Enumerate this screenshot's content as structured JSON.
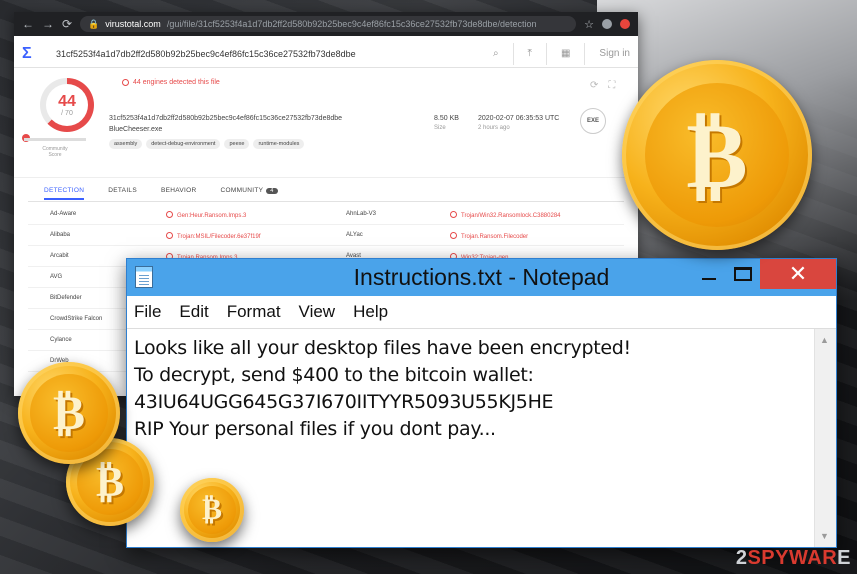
{
  "browser": {
    "url_host": "virustotal.com",
    "url_path": "/gui/file/31cf5253f4a1d7db2ff2d580b92b25bec9c4ef86fc15c36ce27532fb73de8dbe/detection",
    "search_query": "31cf5253f4a1d7db2ff2d580b92b25bec9c4ef86fc15c36ce27532fb73de8dbe",
    "sign_in": "Sign in"
  },
  "summary": {
    "score": "44",
    "score_total": "/ 70",
    "community_label": "Community Score",
    "detected_text": "44 engines detected this file",
    "hash": "31cf5253f4a1d7db2ff2d580b92b25bec9c4ef86fc15c36ce27532fb73de8dbe",
    "filename": "BlueCheeser.exe",
    "tags": [
      "assembly",
      "detect-debug-environment",
      "peexe",
      "runtime-modules"
    ],
    "size": "8.50 KB",
    "size_label": "Size",
    "date": "2020-02-07 06:35:53 UTC",
    "date_sub": "2 hours ago",
    "type": "EXE"
  },
  "tabs": {
    "detection": "DETECTION",
    "details": "DETAILS",
    "behavior": "BEHAVIOR",
    "community": "COMMUNITY",
    "community_count": "4"
  },
  "detections": [
    {
      "engine1": "Ad-Aware",
      "result1": "Gen:Heur.Ransom.Imps.3",
      "engine2": "AhnLab-V3",
      "result2": "Trojan/Win32.Ransomlock.C3880284"
    },
    {
      "engine1": "Alibaba",
      "result1": "Trojan:MSIL/Filecoder.6e37f19f",
      "engine2": "ALYac",
      "result2": "Trojan.Ransom.Filecoder"
    },
    {
      "engine1": "Arcabit",
      "result1": "Trojan.Ransom.Imps.3",
      "engine2": "Avast",
      "result2": "Win32:Trojan-gen"
    },
    {
      "engine1": "AVG",
      "result1": "",
      "engine2": "",
      "result2": ""
    },
    {
      "engine1": "BitDefender",
      "result1": "",
      "engine2": "",
      "result2": ""
    },
    {
      "engine1": "CrowdStrike Falcon",
      "result1": "",
      "engine2": "",
      "result2": ""
    },
    {
      "engine1": "Cylance",
      "result1": "",
      "engine2": "",
      "result2": ""
    },
    {
      "engine1": "DrWeb",
      "result1": "",
      "engine2": "",
      "result2": ""
    }
  ],
  "notepad": {
    "title": "Instructions.txt - Notepad",
    "menu": [
      "File",
      "Edit",
      "Format",
      "View",
      "Help"
    ],
    "lines": [
      "Looks like all your desktop files have been encrypted!",
      "To decrypt, send $400 to the bitcoin wallet:",
      "43IU64UGG645G37I670IITYYR5093U55KJ5HE",
      "RIP Your personal files if you dont pay..."
    ]
  },
  "watermark": {
    "prefix": "2",
    "red": "SPYWAR",
    "suffix": "E"
  },
  "coin_symbol": "₿",
  "colors": {
    "accent": "#3b61ff",
    "danger": "#e64a4a",
    "notepad_title": "#4aa3ea",
    "close": "#d9463e",
    "coin": "#f7b21b"
  }
}
